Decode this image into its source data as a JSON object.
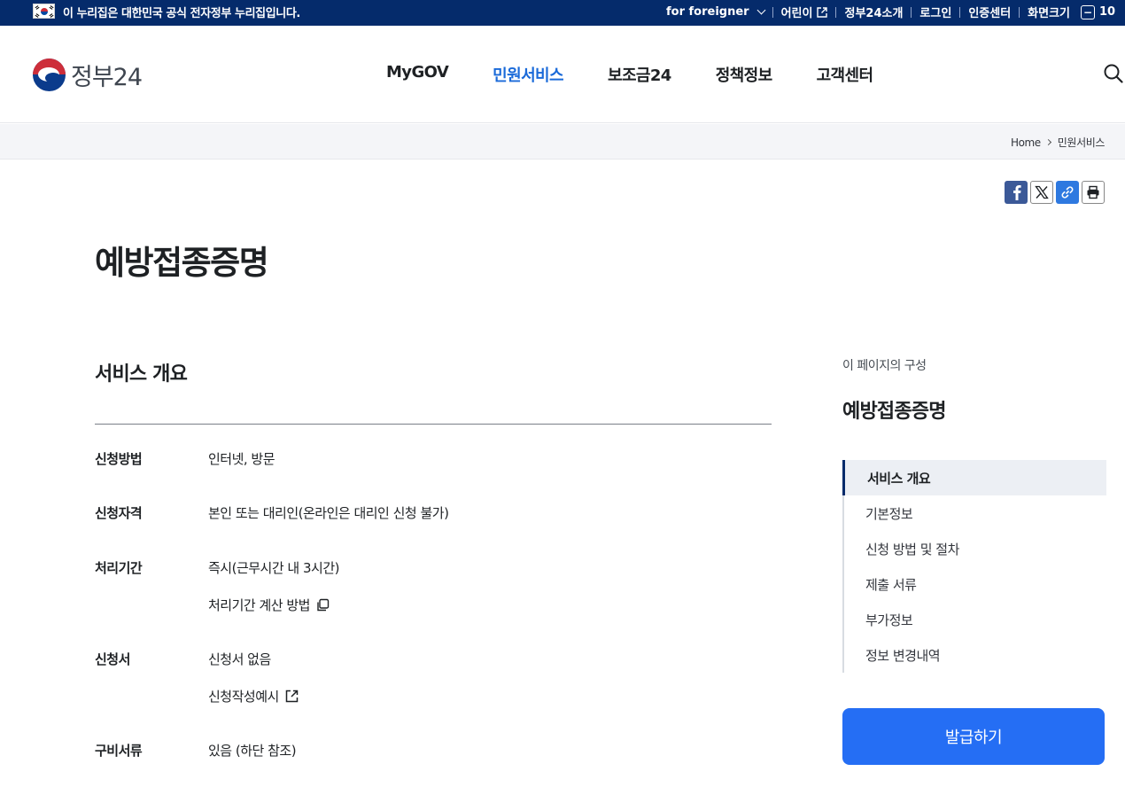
{
  "topbar": {
    "official_notice": "이 누리집은 대한민국 공식 전자정부 누리집입니다.",
    "links": [
      "for foreigner",
      "어린이",
      "정부24소개",
      "로그인",
      "인증센터",
      "화면크기"
    ],
    "zoom_value": "10"
  },
  "header": {
    "brand": "정부24",
    "nav": [
      "MyGOV",
      "민원서비스",
      "보조금24",
      "정책정보",
      "고객센터"
    ],
    "active_nav": "민원서비스"
  },
  "breadcrumb": [
    "Home",
    "민원서비스"
  ],
  "page": {
    "title": "예방접종증명"
  },
  "overview": {
    "title": "서비스 개요",
    "rows": [
      {
        "label": "신청방법",
        "values": [
          "인터넷, 방문"
        ]
      },
      {
        "label": "신청자격",
        "values": [
          "본인 또는 대리인(온라인은 대리인 신청 불가)"
        ]
      },
      {
        "label": "처리기간",
        "values": [
          "즉시(근무시간 내 3시간)",
          "처리기간 계산 방법"
        ]
      },
      {
        "label": "신청서",
        "values": [
          "신청서 없음",
          "신청작성예시"
        ]
      },
      {
        "label": "구비서류",
        "values": [
          "있음 (하단 참조)"
        ]
      }
    ]
  },
  "side": {
    "caption": "이 페이지의 구성",
    "title": "예방접종증명",
    "toc": [
      "서비스 개요",
      "기본정보",
      "신청 방법 및 절차",
      "제출 서류",
      "부가정보",
      "정보 변경내역"
    ],
    "issue_button": "발급하기"
  },
  "colors": {
    "topbar": "#052b6b",
    "active_nav": "#1a6ad9",
    "primary_button": "#256ef4"
  },
  "icons": [
    "korea-flag-icon",
    "chevron-down-icon",
    "external-link-icon",
    "minus-icon",
    "search-icon",
    "facebook-icon",
    "x-icon",
    "link-icon",
    "print-icon",
    "copy-icon"
  ]
}
